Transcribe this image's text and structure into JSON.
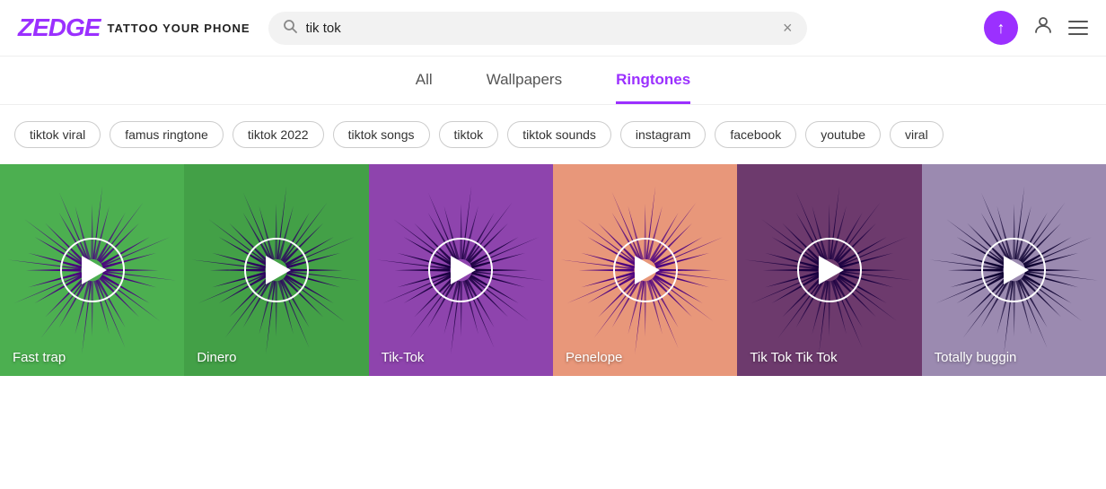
{
  "header": {
    "logo": "ZEDGE",
    "tagline": "TATTOO YOUR PHONE",
    "search_value": "tik tok",
    "search_placeholder": "tik tok",
    "clear_label": "×",
    "upload_icon": "↑",
    "user_icon": "👤"
  },
  "nav": {
    "tabs": [
      {
        "label": "All",
        "active": false
      },
      {
        "label": "Wallpapers",
        "active": false
      },
      {
        "label": "Ringtones",
        "active": true
      }
    ]
  },
  "chips": [
    "tiktok viral",
    "famus ringtone",
    "tiktok 2022",
    "tiktok songs",
    "tiktok",
    "tiktok sounds",
    "instagram",
    "facebook",
    "youtube",
    "viral"
  ],
  "cards": [
    {
      "title": "Fast trap",
      "bg": "#4caf50",
      "petal_color": "#4a0080"
    },
    {
      "title": "Dinero",
      "bg": "#43a047",
      "petal_color": "#2d0060"
    },
    {
      "title": "Tik-Tok",
      "bg": "#8e44ad",
      "petal_color": "#1a0040"
    },
    {
      "title": "Penelope",
      "bg": "#e8977a",
      "petal_color": "#4a0080"
    },
    {
      "title": "Tik Tok Tik Tok",
      "bg": "#6d3a6d",
      "petal_color": "#1a0040"
    },
    {
      "title": "Totally buggin",
      "bg": "#9b8ab0",
      "petal_color": "#0d0030"
    }
  ],
  "colors": {
    "brand_purple": "#9b30ff",
    "active_tab_color": "#9b30ff"
  }
}
